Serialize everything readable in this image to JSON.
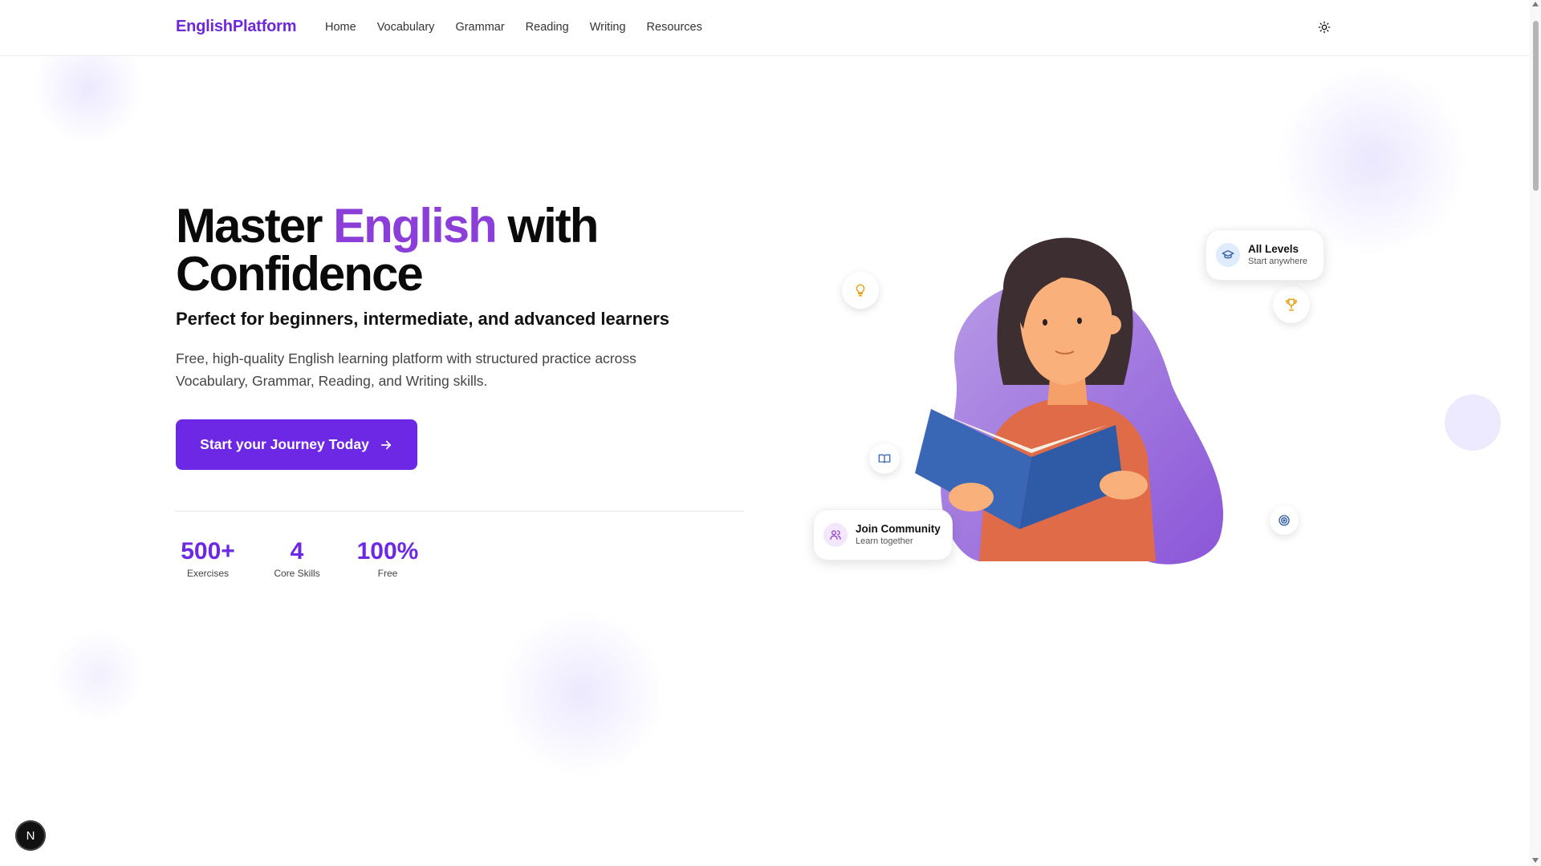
{
  "header": {
    "logo": "EnglishPlatform",
    "nav": [
      "Home",
      "Vocabulary",
      "Grammar",
      "Reading",
      "Writing",
      "Resources"
    ],
    "theme_icon": "sun-icon"
  },
  "hero": {
    "title_part1": "Master ",
    "title_accent": "English",
    "title_part2": " with Confidence",
    "subtitle": "Perfect for beginners, intermediate, and advanced learners",
    "description": "Free, high-quality English learning platform with structured practice across Vocabulary, Grammar, Reading, and Writing skills.",
    "cta_label": "Start your Journey Today"
  },
  "stats": [
    {
      "value": "500+",
      "label": "Exercises"
    },
    {
      "value": "4",
      "label": "Core Skills"
    },
    {
      "value": "100%",
      "label": "Free"
    }
  ],
  "cards": {
    "levels": {
      "title": "All Levels",
      "subtitle": "Start anywhere",
      "icon": "graduation-cap-icon"
    },
    "community": {
      "title": "Join Community",
      "subtitle": "Learn together",
      "icon": "users-icon"
    }
  },
  "floating_icons": [
    "lightbulb-icon",
    "trophy-icon",
    "book-open-icon",
    "target-icon"
  ],
  "next_badge": "N",
  "colors": {
    "accent": "#6d28e6",
    "accent_gradient": "#8b3fd8",
    "logo": "#6d28d9"
  }
}
